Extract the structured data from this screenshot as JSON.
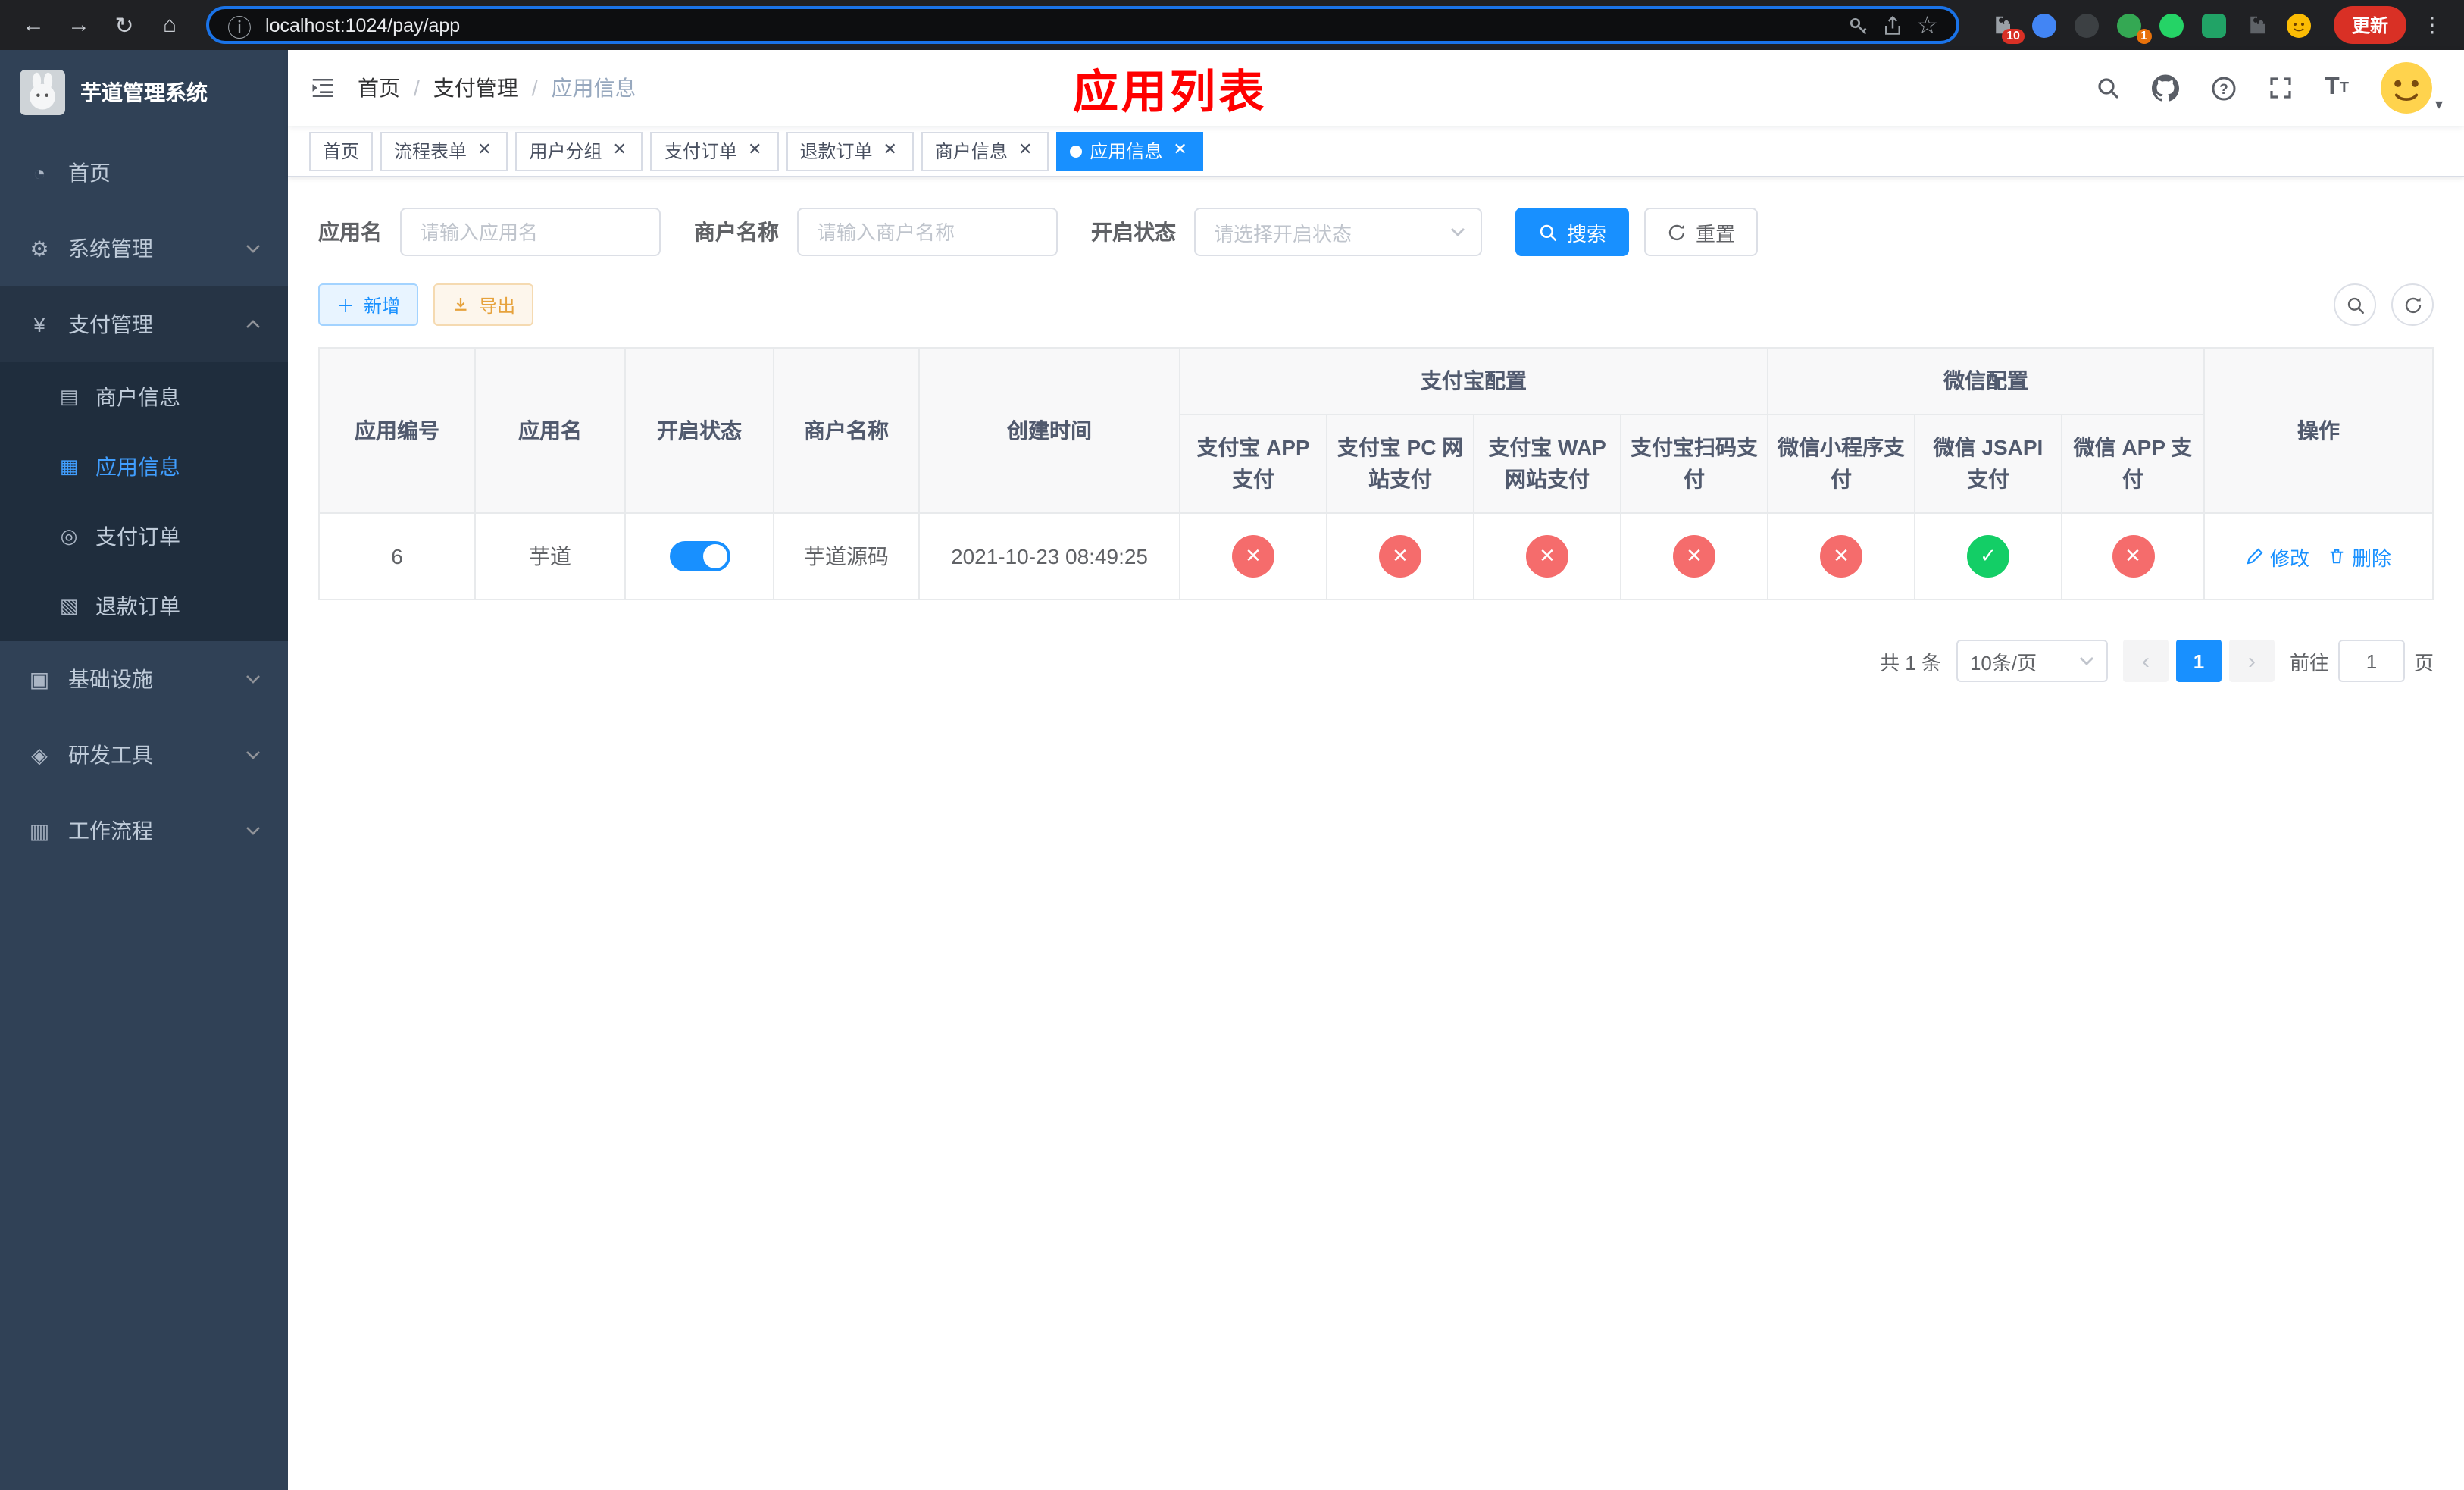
{
  "browser": {
    "url": "localhost:1024/pay/app",
    "update_button": "更新",
    "extension_badge_1": "10",
    "extension_badge_2": "1"
  },
  "sidebar": {
    "title": "芋道管理系统",
    "items": [
      {
        "label": "首页"
      },
      {
        "label": "系统管理"
      },
      {
        "label": "支付管理"
      },
      {
        "label": "基础设施"
      },
      {
        "label": "研发工具"
      },
      {
        "label": "工作流程"
      }
    ],
    "pay_children": [
      {
        "label": "商户信息"
      },
      {
        "label": "应用信息"
      },
      {
        "label": "支付订单"
      },
      {
        "label": "退款订单"
      }
    ]
  },
  "navbar": {
    "breadcrumb": [
      "首页",
      "支付管理",
      "应用信息"
    ],
    "annotation": "应用列表"
  },
  "tags": [
    {
      "label": "首页"
    },
    {
      "label": "流程表单"
    },
    {
      "label": "用户分组"
    },
    {
      "label": "支付订单"
    },
    {
      "label": "退款订单"
    },
    {
      "label": "商户信息"
    },
    {
      "label": "应用信息"
    }
  ],
  "filters": {
    "app_name_label": "应用名",
    "app_name_placeholder": "请输入应用名",
    "merchant_label": "商户名称",
    "merchant_placeholder": "请输入商户名称",
    "status_label": "开启状态",
    "status_placeholder": "请选择开启状态",
    "search_button": "搜索",
    "reset_button": "重置"
  },
  "toolbar": {
    "add_button": "新增",
    "export_button": "导出"
  },
  "table": {
    "headers": {
      "app_id": "应用编号",
      "app_name": "应用名",
      "status": "开启状态",
      "merchant": "商户名称",
      "created_at": "创建时间",
      "alipay_group": "支付宝配置",
      "alipay_app": "支付宝 APP 支付",
      "alipay_pc": "支付宝 PC 网站支付",
      "alipay_wap": "支付宝 WAP 网站支付",
      "alipay_qr": "支付宝扫码支付",
      "wechat_group": "微信配置",
      "wechat_mini": "微信小程序支付",
      "wechat_jsapi": "微信 JSAPI 支付",
      "wechat_app": "微信 APP 支付",
      "actions": "操作"
    },
    "row": {
      "app_id": "6",
      "app_name": "芋道",
      "enabled": true,
      "merchant": "芋道源码",
      "created_at": "2021-10-23 08:49:25",
      "statuses": [
        "disabled",
        "disabled",
        "disabled",
        "disabled",
        "disabled",
        "enabled",
        "disabled"
      ],
      "edit_label": "修改",
      "delete_label": "删除"
    }
  },
  "pagination": {
    "total": "共 1 条",
    "page_size": "10条/页",
    "current_page": "1",
    "goto_label": "前往",
    "goto_value": "1",
    "goto_suffix": "页"
  },
  "colors": {
    "primary": "#1890ff",
    "danger": "#f56c6c",
    "success": "#13ce66",
    "annotation_red": "#ff0000",
    "sidebar_bg": "#304156"
  }
}
